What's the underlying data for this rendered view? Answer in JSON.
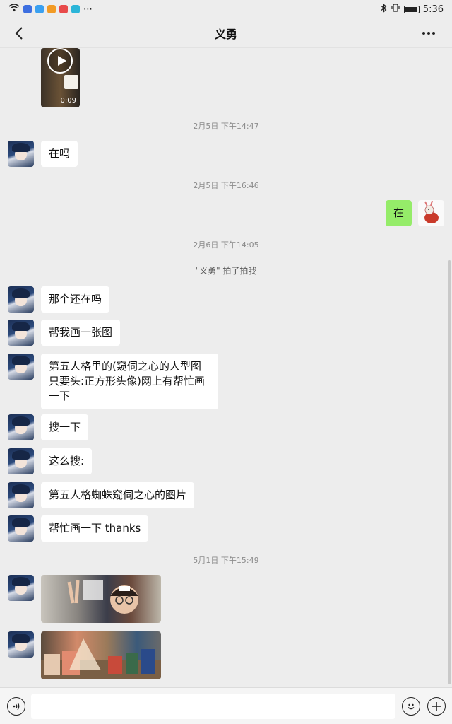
{
  "status": {
    "time": "5:36"
  },
  "header": {
    "title": "义勇"
  },
  "video": {
    "duration": "0:09"
  },
  "messages": {
    "ts1": "2月5日 下午14:47",
    "m1": "在吗",
    "ts2": "2月5日 下午16:46",
    "mine1": "在",
    "ts3": "2月6日 下午14:05",
    "system": "\"义勇\" 拍了拍我",
    "m2": "那个还在吗",
    "m3": "帮我画一张图",
    "m4_line1": "第五人格里的(窥伺之心的人型图",
    "m4_line2": "只要头:正方形头像)网上有帮忙画",
    "m4_line3": "一下",
    "m5": "搜一下",
    "m6": "这么搜:",
    "m7": "第五人格蜘蛛窥伺之心的图片",
    "m8": "帮忙画一下 thanks",
    "ts4": "5月1日 下午15:49"
  },
  "colors": {
    "background": "#ededed",
    "my_bubble": "#95ec69",
    "their_bubble": "#ffffff"
  }
}
